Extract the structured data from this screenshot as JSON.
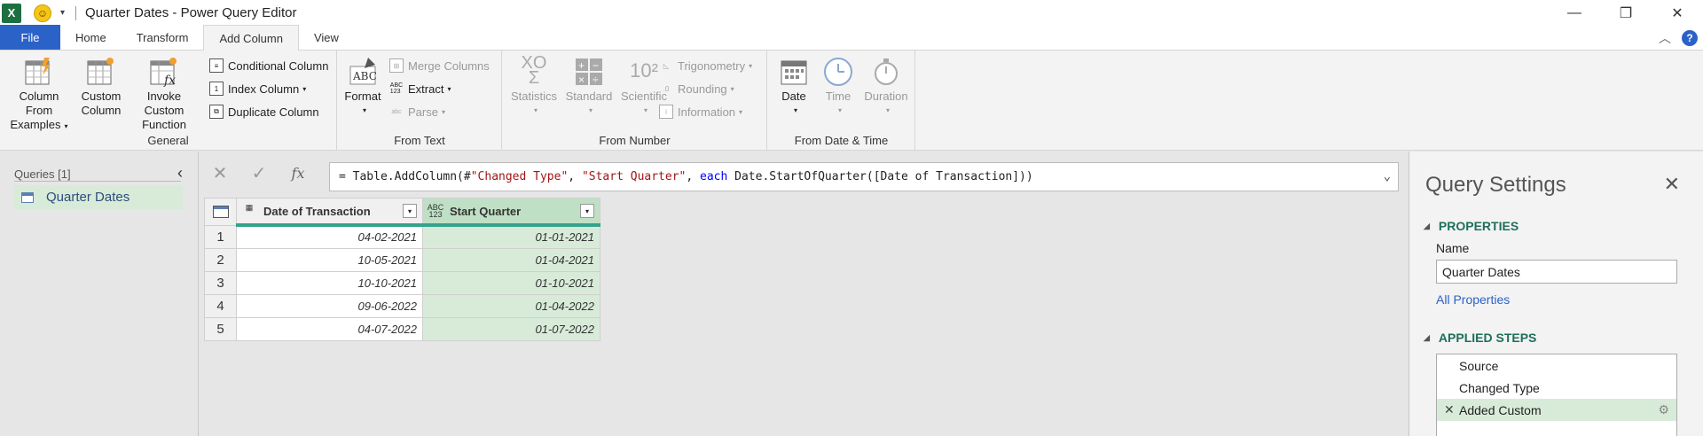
{
  "window": {
    "app_icon": "X",
    "title": "Quarter Dates - Power Query Editor",
    "controls": [
      "minimize-icon",
      "restore-icon",
      "close-icon"
    ]
  },
  "tabs": [
    "File",
    "Home",
    "Transform",
    "Add Column",
    "View"
  ],
  "active_tab": "Add Column",
  "ribbon": {
    "general": {
      "label": "General",
      "column_from_examples_1": "Column From",
      "column_from_examples_2": "Examples",
      "custom_column_1": "Custom",
      "custom_column_2": "Column",
      "invoke_custom_1": "Invoke Custom",
      "invoke_custom_2": "Function",
      "conditional_column": "Conditional Column",
      "index_column": "Index Column",
      "duplicate_column": "Duplicate Column"
    },
    "from_text": {
      "label": "From Text",
      "format": "Format",
      "merge_columns": "Merge Columns",
      "extract": "Extract",
      "parse": "Parse"
    },
    "from_number": {
      "label": "From Number",
      "statistics": "Statistics",
      "standard": "Standard",
      "scientific": "Scientific",
      "trigonometry": "Trigonometry",
      "rounding": "Rounding",
      "information": "Information"
    },
    "from_date_time": {
      "label": "From Date & Time",
      "date": "Date",
      "time": "Time",
      "duration": "Duration"
    }
  },
  "queries": {
    "header": "Queries [1]",
    "items": [
      "Quarter Dates"
    ]
  },
  "formula": {
    "prefix": "= Table.AddColumn(#",
    "str1": "\"Changed Type\"",
    "sep1": ", ",
    "str2": "\"Start Quarter\"",
    "sep2": ", ",
    "kw": "each",
    "rest": " Date.StartOfQuarter([Date of Transaction]))"
  },
  "table": {
    "columns": [
      {
        "name": "Date of Transaction",
        "type_icon": "calendar-icon"
      },
      {
        "name": "Start Quarter",
        "type_icon": "ABC 123"
      }
    ],
    "rows": [
      {
        "n": "1",
        "c1": "04-02-2021",
        "c2": "01-01-2021"
      },
      {
        "n": "2",
        "c1": "10-05-2021",
        "c2": "01-04-2021"
      },
      {
        "n": "3",
        "c1": "10-10-2021",
        "c2": "01-10-2021"
      },
      {
        "n": "4",
        "c1": "09-06-2022",
        "c2": "01-04-2022"
      },
      {
        "n": "5",
        "c1": "04-07-2022",
        "c2": "01-07-2022"
      }
    ]
  },
  "settings": {
    "title": "Query Settings",
    "properties_title": "PROPERTIES",
    "name_label": "Name",
    "name_value": "Quarter Dates",
    "all_properties": "All Properties",
    "applied_steps_title": "APPLIED STEPS",
    "steps": [
      "Source",
      "Changed Type",
      "Added Custom"
    ],
    "active_step": "Added Custom"
  },
  "colors": {
    "file_tab": "#2b62c8",
    "accent_green": "#1f6f5a",
    "selected_bg": "#d8ebd9",
    "column_underline": "#33a38a",
    "string_literal": "#a31515",
    "keyword": "#0000ff"
  }
}
